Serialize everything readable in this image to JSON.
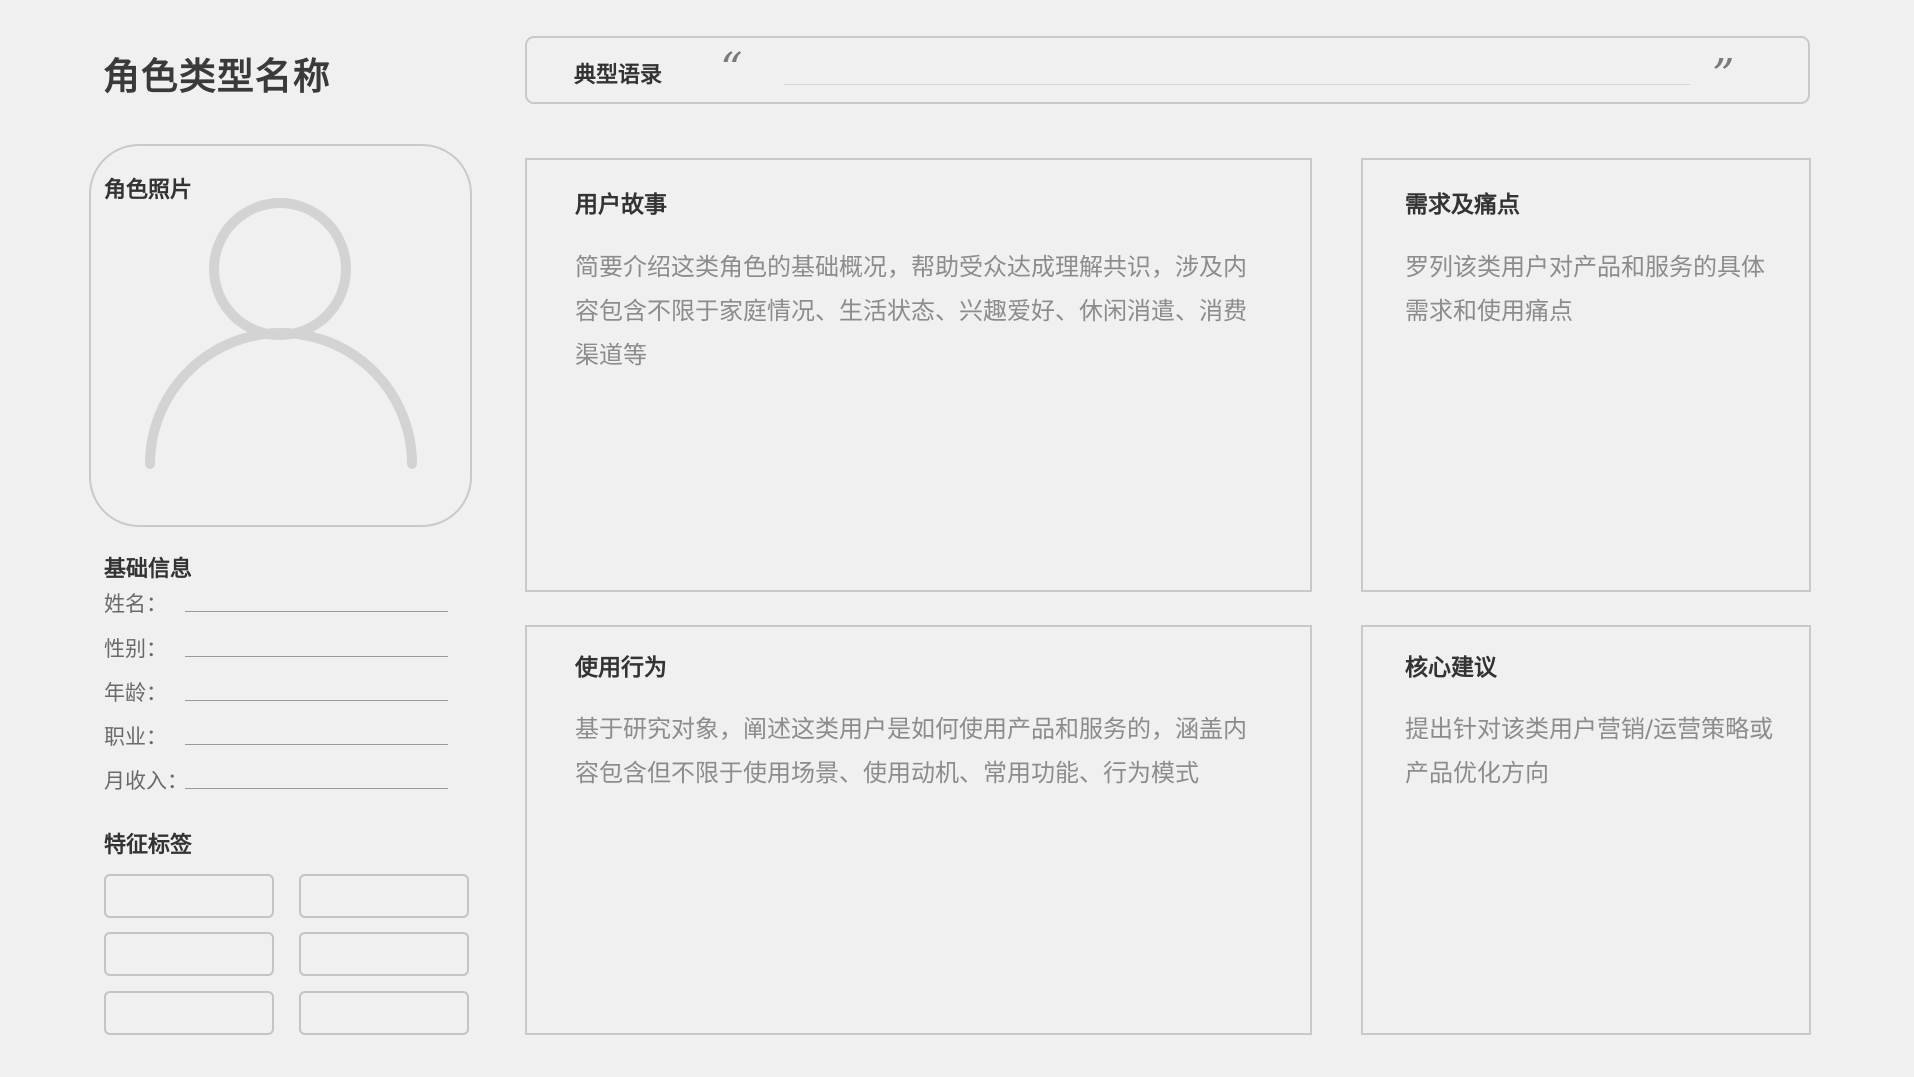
{
  "page_title": "角色类型名称",
  "quote": {
    "label": "典型语录",
    "open_mark": "“",
    "close_mark": "”"
  },
  "photo": {
    "label": "角色照片",
    "icon": "user-avatar-icon"
  },
  "basic_info": {
    "title": "基础信息",
    "fields": [
      {
        "label": "姓名："
      },
      {
        "label": "性别："
      },
      {
        "label": "年龄："
      },
      {
        "label": "职业："
      },
      {
        "label": "月收入："
      }
    ]
  },
  "tags": {
    "title": "特征标签",
    "count": 6
  },
  "panels": {
    "user_story": {
      "title": "用户故事",
      "body": "简要介绍这类角色的基础概况，帮助受众达成理解共识，涉及内容包含不限于家庭情况、生活状态、兴趣爱好、休闲消遣、消费渠道等"
    },
    "needs": {
      "title": "需求及痛点",
      "body": "罗列该类用户对产品和服务的具体需求和使用痛点"
    },
    "behavior": {
      "title": "使用行为",
      "body": "基于研究对象，阐述这类用户是如何使用产品和服务的，涵盖内容包含但不限于使用场景、使用动机、常用功能、行为模式"
    },
    "advice": {
      "title": "核心建议",
      "body": "提出针对该类用户营销/运营策略或产品优化方向"
    }
  },
  "colors": {
    "background": "#f0f0f0",
    "border": "#c9c9c9",
    "title_text": "#333333",
    "body_text": "#8c8c8c",
    "avatar_stroke": "#d3d3d3"
  }
}
